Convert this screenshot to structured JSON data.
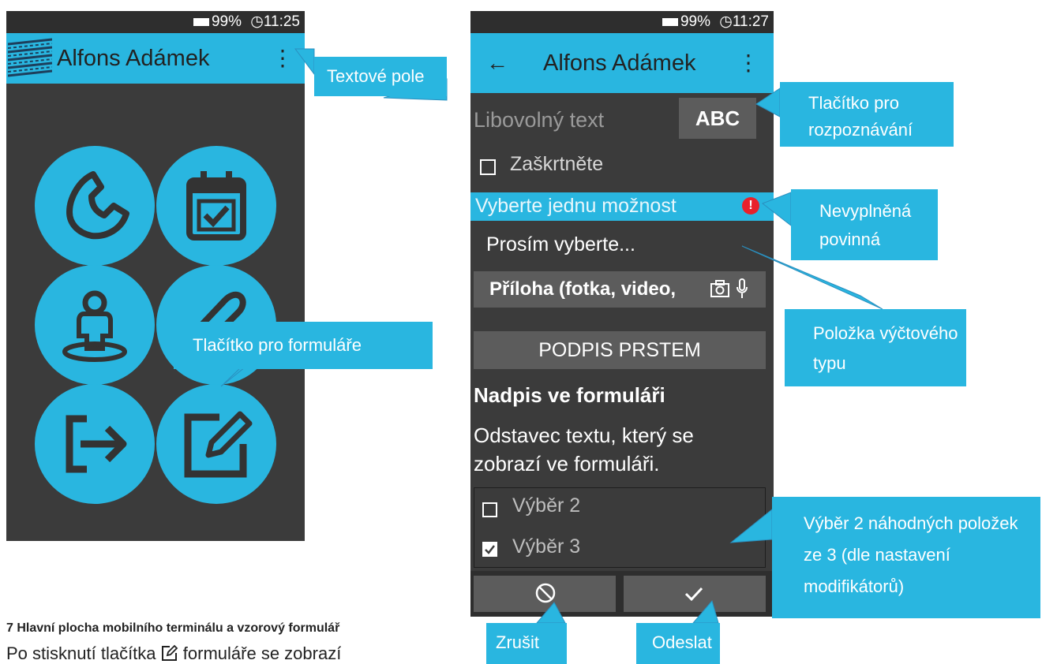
{
  "phone1": {
    "status": {
      "battery": "99%",
      "time": "11:25"
    },
    "title": "Alfons Adámek",
    "menu_glyph": "⋮",
    "tiles": [
      {
        "icon": "phone-icon"
      },
      {
        "icon": "calendar-check-icon"
      },
      {
        "icon": "person-location-icon"
      },
      {
        "icon": "paperclip-icon"
      },
      {
        "icon": "logout-icon"
      },
      {
        "icon": "edit-form-icon"
      }
    ]
  },
  "phone2": {
    "status": {
      "battery": "99%",
      "time": "11:27"
    },
    "title": "Alfons Adámek",
    "back_glyph": "←",
    "menu_glyph": "⋮",
    "text_field_placeholder": "Libovolný text",
    "ocr_button": "ABC",
    "checkbox_label": "Zaškrtněte",
    "select_label": "Vyberte jednu možnost",
    "select_value": "Prosím vyberte...",
    "attachment_button": "Příloha (fotka, video,",
    "signature_button": "PODPIS PRSTEM",
    "form_heading": "Nadpis ve formuláři",
    "form_paragraph": "Odstavec textu, který se zobrazí ve formuláři.",
    "choices": [
      {
        "label": "Výběr 2",
        "checked": false
      },
      {
        "label": "Výběr 3",
        "checked": true
      }
    ]
  },
  "callouts": {
    "text_field": "Textové pole",
    "ocr": "Tlačítko pro rozpoznávání textu",
    "required": "Nevyplněná povinná položka",
    "enum": "Položka výčtového typu",
    "forms_button": "Tlačítko pro formuláře",
    "random_choice": "Výběr 2 náhodných položek ze 3 (dle nastavení modifikátorů)",
    "cancel": "Zrušit",
    "submit": "Odeslat"
  },
  "caption": "7 Hlavní plocha mobilního terminálu a vzorový formulář",
  "body_text_before": "Po stisknutí tlačítka",
  "body_text_after": "formuláře se zobrazí",
  "colors": {
    "accent": "#29b6e0",
    "phone_bg": "#3b3b3b",
    "button_grey": "#5c5c5c",
    "error": "#e8212b"
  }
}
